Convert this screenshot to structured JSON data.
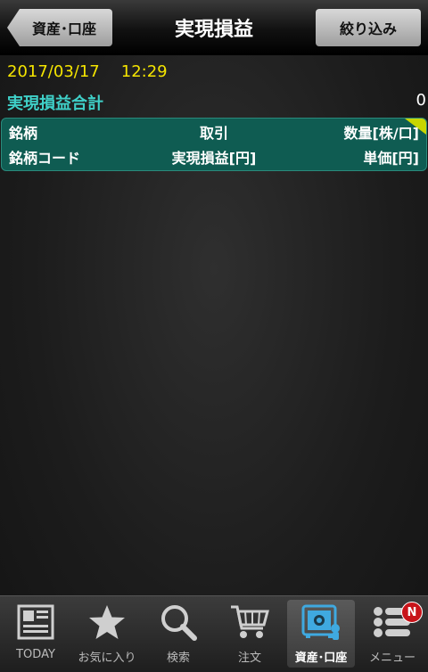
{
  "header": {
    "back_label": "資産･口座",
    "title": "実現損益",
    "filter_label": "絞り込み"
  },
  "summary": {
    "date": "2017/03/17",
    "time": "12:29",
    "total_label": "実現損益合計",
    "total_value": "0"
  },
  "table_header": {
    "row1": [
      "銘柄",
      "取引",
      "数量[株/口]"
    ],
    "row2": [
      "銘柄コード",
      "実現損益[円]",
      "単価[円]"
    ]
  },
  "tabbar": {
    "items": [
      {
        "label": "TODAY",
        "icon": "newspaper-icon"
      },
      {
        "label": "お気に入り",
        "icon": "star-icon"
      },
      {
        "label": "検索",
        "icon": "search-icon"
      },
      {
        "label": "注文",
        "icon": "cart-icon"
      },
      {
        "label": "資産･口座",
        "icon": "safe-icon"
      },
      {
        "label": "メニュー",
        "icon": "menu-list-icon"
      }
    ],
    "active_index": 4,
    "badge": "N"
  },
  "colors": {
    "accent_yellow": "#f4e400",
    "accent_cyan": "#3fd0c8",
    "table_header_bg": "#0f5c52",
    "active_tab_icon": "#3fa9e0",
    "badge_red": "#c8141a"
  }
}
